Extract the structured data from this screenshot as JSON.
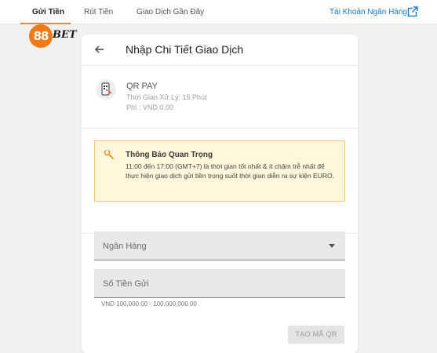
{
  "topnav": {
    "tabs": [
      {
        "label": "Gửi Tiền",
        "active": true
      },
      {
        "label": "Rút Tiền",
        "active": false
      },
      {
        "label": "Giao Dịch Gần Đây",
        "active": false
      }
    ],
    "bank_account_link": "Tài Khoản Ngân Hàng",
    "external_icon": "external-link-icon"
  },
  "logo": {
    "number": "88",
    "text": "BET"
  },
  "card": {
    "title": "Nhập Chi Tiết Giao Dịch",
    "back_icon": "arrow-left-icon",
    "payment_method": {
      "icon": "qr-phone-icon",
      "name": "QR PAY",
      "processing_time": "Thời Gian Xử Lý: 15 Phút",
      "fee": "Phí : VND 0.00"
    },
    "notice": {
      "icon": "wrench-icon",
      "title": "Thông Báo Quan Trọng",
      "body": "11:00 đến 17:00 (GMT+7) là thời gian tốt nhất & ít chậm trễ nhất để thực hiện giao dịch gửi tiền trong suốt thời gian diễn ra sự kiện EURO."
    },
    "bank_field": {
      "label": "Ngân Hàng"
    },
    "amount_field": {
      "label": "Số Tiền Gửi",
      "hint": "VND 100,000.00 - 100,000,000.00"
    },
    "submit_label": "TẠO MÃ QR"
  },
  "colors": {
    "accent": "#f18a1d",
    "link": "#1a78c8",
    "notice_bg": "#fff6dc",
    "notice_border": "#f0c36b"
  }
}
